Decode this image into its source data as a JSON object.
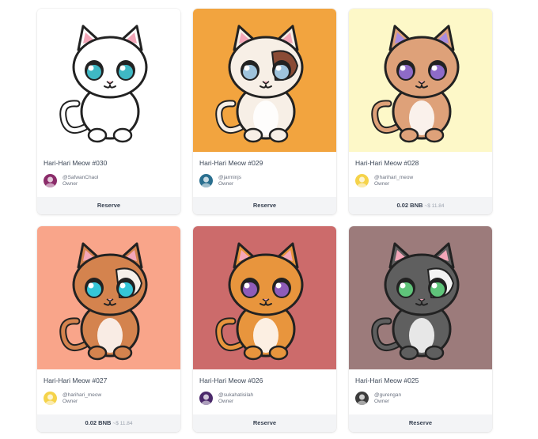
{
  "cards": [
    {
      "title": "Hari-Hari Meow #030",
      "handle": "@SafwanChaol",
      "role": "Owner",
      "action": "Reserve",
      "bg": "#ffffff",
      "body": "#ffffff",
      "patch": "",
      "eye": "#3fb8c4",
      "ear": "#f4a7b9",
      "avatar_bg": "#8b2c6a"
    },
    {
      "title": "Hari-Hari Meow #029",
      "handle": "@jarminjs",
      "role": "Owner",
      "action": "Reserve",
      "bg": "#f2a43f",
      "body": "#f7efe6",
      "patch": "#8a4b35",
      "eye": "#9ec3dc",
      "ear": "#f4a7b9",
      "avatar_bg": "#2a6f8f"
    },
    {
      "title": "Hari-Hari Meow #028",
      "handle": "@harihari_meow",
      "role": "Owner",
      "price": "0.02 BNB",
      "usd": "~$ 11.84",
      "bg": "#fdf8c8",
      "body": "#dea179",
      "patch": "",
      "eye": "#8e6bc8",
      "ear": "#a88ce0",
      "avatar_bg": "#f5d34a"
    },
    {
      "title": "Hari-Hari Meow #027",
      "handle": "@harihari_meow",
      "role": "Owner",
      "price": "0.02 BNB",
      "usd": "~$ 11.84",
      "bg": "#f9a58a",
      "body": "#d4834e",
      "patch": "#f6f0ea",
      "eye": "#35c6d8",
      "ear": "#f4a7b9",
      "avatar_bg": "#f5d34a"
    },
    {
      "title": "Hari-Hari Meow #026",
      "handle": "@sukahatisilah",
      "role": "Owner",
      "action": "Reserve",
      "bg": "#cc6b6b",
      "body": "#e8953d",
      "patch": "",
      "eye": "#8e5cb8",
      "ear": "#f4a7b9",
      "avatar_bg": "#4b2a6b"
    },
    {
      "title": "Hari-Hari Meow #025",
      "handle": "@gurengan",
      "role": "Owner",
      "action": "Reserve",
      "bg": "#9c7b7b",
      "body": "#5f5f5f",
      "patch": "#f3f3f3",
      "eye": "#5fc47a",
      "ear": "#f4a7b9",
      "avatar_bg": "#3c3c3c"
    }
  ]
}
